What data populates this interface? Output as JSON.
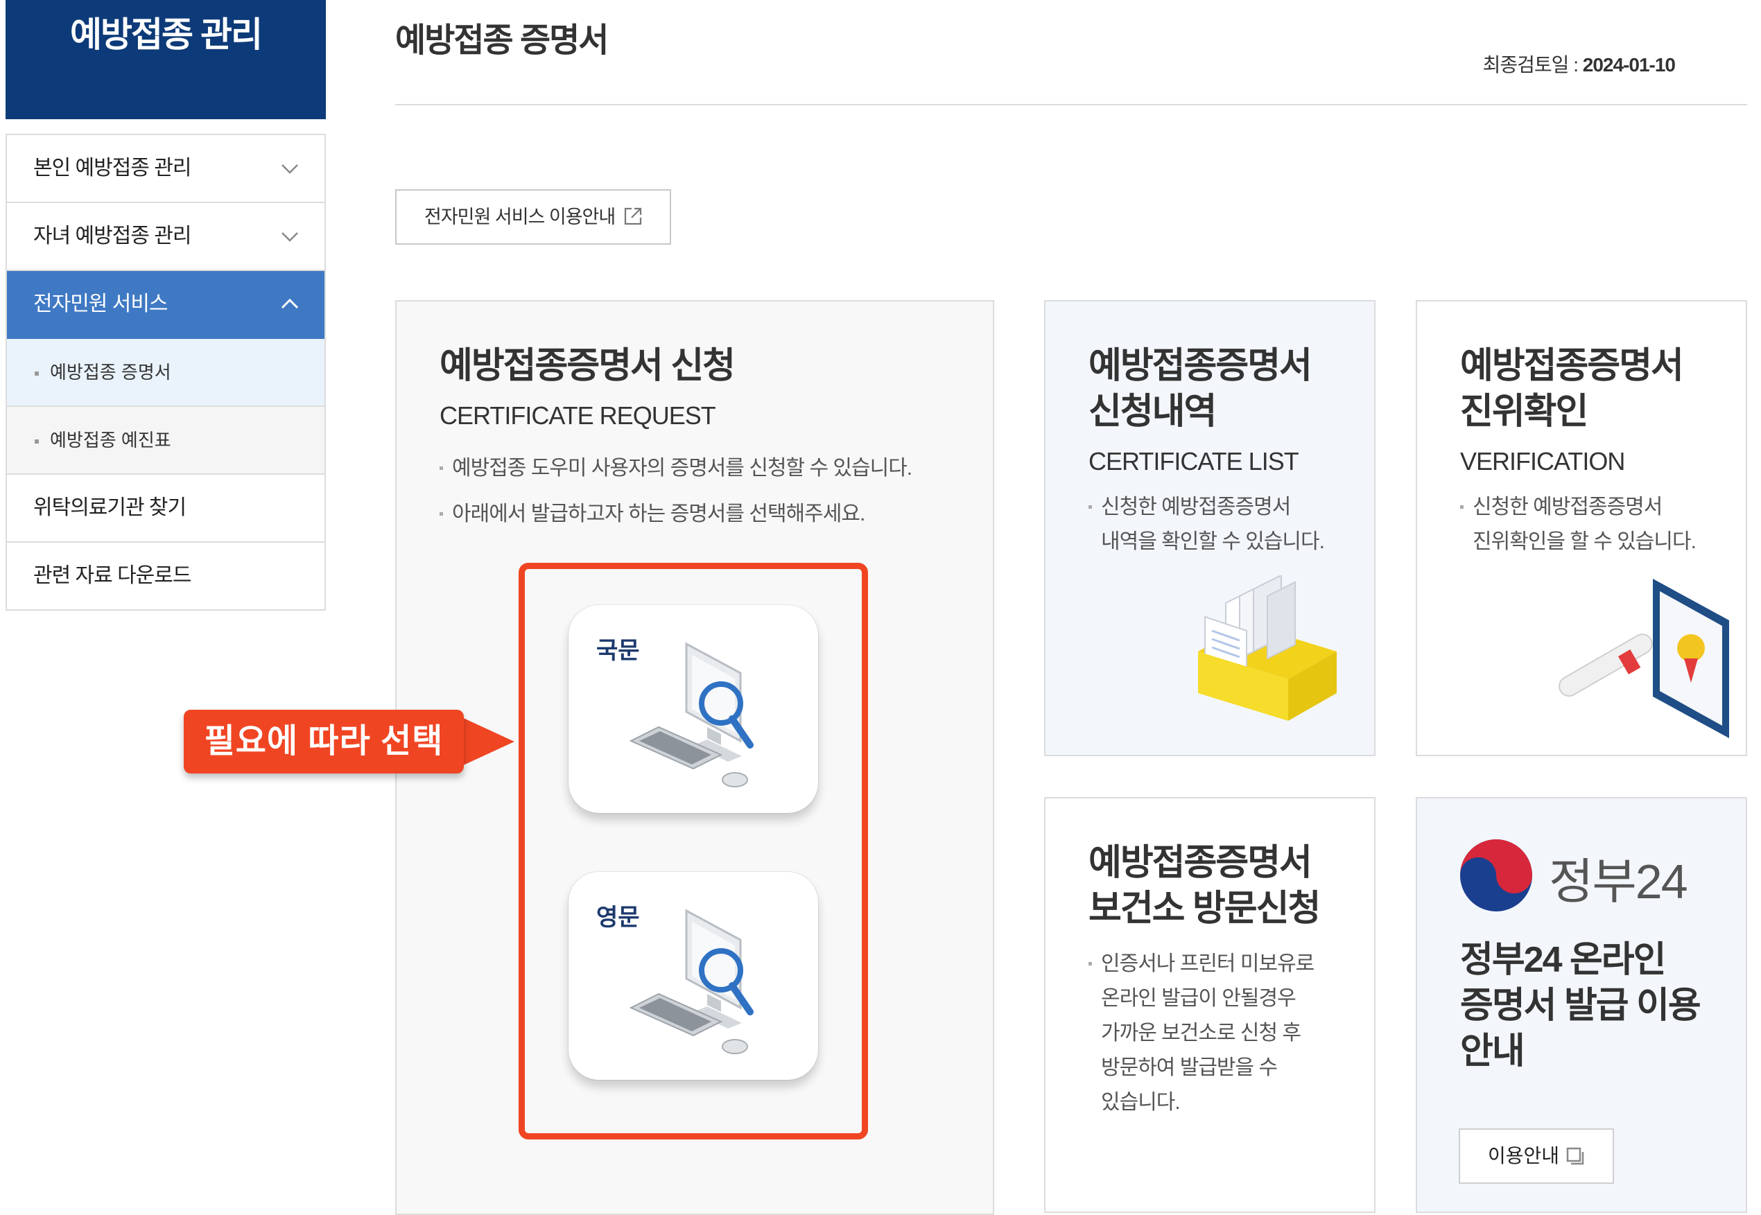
{
  "sidebar": {
    "title": "예방접종 관리",
    "items": [
      {
        "label": "본인 예방접종 관리"
      },
      {
        "label": "자녀 예방접종 관리"
      },
      {
        "label": "전자민원 서비스"
      },
      {
        "label": "예방접종 증명서"
      },
      {
        "label": "예방접종 예진표"
      },
      {
        "label": "위탁의료기관 찾기"
      },
      {
        "label": "관련 자료 다운로드"
      }
    ]
  },
  "header": {
    "title": "예방접종 증명서",
    "review_label": "최종검토일 : ",
    "review_date": "2024-01-10"
  },
  "guide_button": {
    "label": "전자민원 서비스 이용안내"
  },
  "cards": {
    "request": {
      "title": "예방접종증명서 신청",
      "subtitle": "CERTIFICATE REQUEST",
      "desc1": "예방접종 도우미 사용자의 증명서를 신청할 수 있습니다.",
      "desc2": "아래에서 발급하고자 하는 증명서를 선택해주세요.",
      "korean_label": "국문",
      "english_label": "영문"
    },
    "list": {
      "title1": "예방접종증명서",
      "title2": "신청내역",
      "subtitle": "CERTIFICATE LIST",
      "desc1": "신청한 예방접종증명서",
      "desc2": "내역을 확인할 수 있습니다."
    },
    "verify": {
      "title1": "예방접종증명서",
      "title2": "진위확인",
      "subtitle": "VERIFICATION",
      "desc1": "신청한 예방접종증명서",
      "desc2": "진위확인을 할 수 있습니다."
    },
    "visit": {
      "title1": "예방접종증명서",
      "title2": "보건소 방문신청",
      "desc1": "인증서나 프린터 미보유로",
      "desc2": "온라인 발급이 안될경우",
      "desc3": "가까운 보건소로 신청 후",
      "desc4": "방문하여 발급받을 수",
      "desc5": "있습니다."
    },
    "gov24": {
      "logo_text": "정부24",
      "title1": "정부24 온라인",
      "title2": "증명서 발급 이용",
      "title3": "안내",
      "button": "이용안내"
    }
  },
  "callout": {
    "text": "필요에 따라 선택"
  },
  "colors": {
    "sidebar_header": "#0d3a78",
    "active_menu": "#3f79c4",
    "highlight": "#f04523"
  }
}
